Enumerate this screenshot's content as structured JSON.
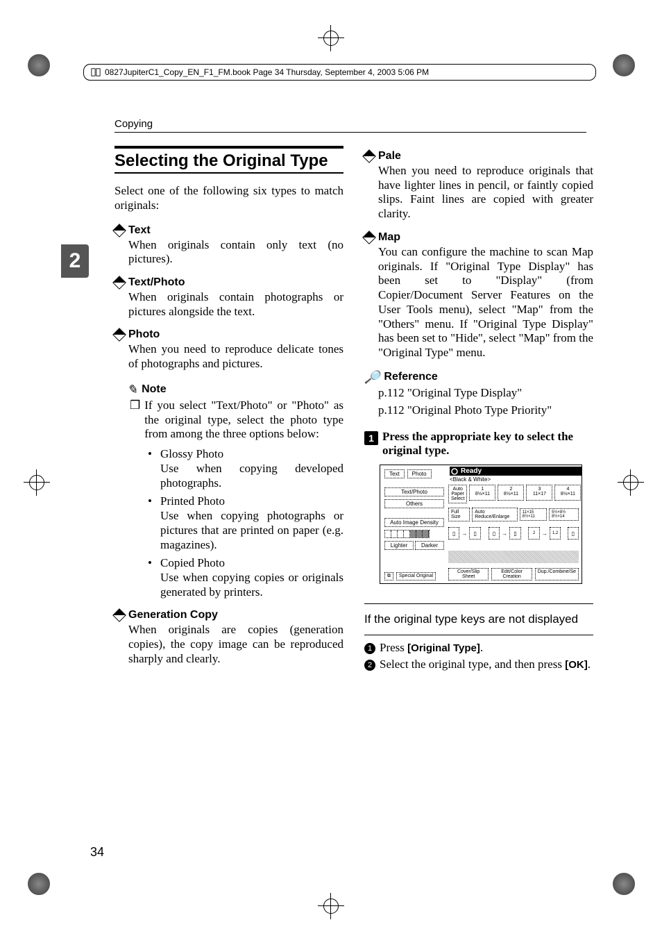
{
  "print": {
    "header": "0827JupiterC1_Copy_EN_F1_FM.book  Page 34  Thursday, September 4, 2003  5:06 PM"
  },
  "page": {
    "chapter_label": "Copying",
    "chapter_tab": "2",
    "number": "34"
  },
  "left": {
    "title": "Selecting the Original Type",
    "intro": "Select one of the following six types to match originals:",
    "items": [
      {
        "head": "Text",
        "body": "When originals contain only text (no pictures)."
      },
      {
        "head": "Text/Photo",
        "body": "When originals contain photographs or pictures alongside the text."
      },
      {
        "head": "Photo",
        "body": "When you need to reproduce delicate tones of photographs and pictures."
      }
    ],
    "note_head": "Note",
    "note_list_intro": "If you select \"Text/Photo\" or \"Photo\" as the original type, select the photo type from among the three options below:",
    "bullets": [
      {
        "name": "Glossy Photo",
        "desc": "Use when copying developed photographs."
      },
      {
        "name": "Printed Photo",
        "desc": "Use when copying photographs or pictures that are printed on paper (e.g. magazines)."
      },
      {
        "name": "Copied Photo",
        "desc": "Use when copying copies or originals generated by printers."
      }
    ],
    "gen": {
      "head": "Generation Copy",
      "body": "When originals are copies (generation copies), the copy image can be reproduced sharply and clearly."
    }
  },
  "right": {
    "pale": {
      "head": "Pale",
      "body": "When you need to reproduce originals that have lighter lines in pencil, or faintly copied slips. Faint lines are copied with greater clarity."
    },
    "map": {
      "head": "Map",
      "body": "You can configure the machine to scan Map originals. If \"Original Type Display\" has been set to \"Display\" (from Copier/Document Server Features on the User Tools menu), select \"Map\" from the \"Others\" menu. If \"Original Type Display\" has been set to \"Hide\", select \"Map\" from the \"Original Type\" menu."
    },
    "reference_head": "Reference",
    "references": [
      "p.112 \"Original Type Display\"",
      "p.112 \"Original Photo Type Priority\""
    ],
    "step1": "Press the appropriate key to select the original type.",
    "panel": {
      "tabs": [
        "Text",
        "Photo"
      ],
      "ready": "Ready",
      "mode": "<Black & White>",
      "left_buttons": [
        "Text/Photo",
        "Others",
        "Auto Image Density",
        "Lighter",
        "Darker",
        "Special Original"
      ],
      "trays": [
        {
          "top": "1",
          "bot": "8½×11"
        },
        {
          "top": "2",
          "bot": "8½×11"
        },
        {
          "top": "3",
          "bot": "11×17"
        },
        {
          "top": "4",
          "bot": "8½×11"
        }
      ],
      "row2": [
        "Auto Paper Select",
        "Full Size",
        "Auto Reduce/Enlarge",
        "11×15 8½×11",
        "5½×8½ 8½×14"
      ],
      "bottom": [
        "Cover/Slip Sheet",
        "Edit/Color Creation",
        "Dup./Combine/Se"
      ]
    },
    "sub_title": "If the original type keys are not displayed",
    "sub_steps": [
      {
        "n": "1",
        "text_a": "Press ",
        "bold": "[Original Type]",
        "text_b": "."
      },
      {
        "n": "2",
        "text_a": "Select the original type, and then press ",
        "bold": "[OK]",
        "text_b": "."
      }
    ]
  }
}
